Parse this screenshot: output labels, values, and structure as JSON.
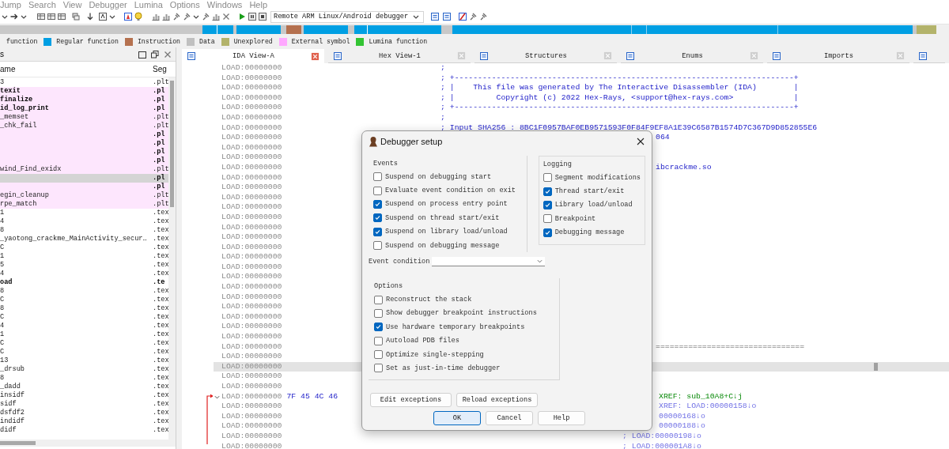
{
  "menu": [
    "Jump",
    "Search",
    "View",
    "Debugger",
    "Lumina",
    "Options",
    "Windows",
    "Help"
  ],
  "toolbar": {
    "debugger": "Remote ARM Linux/Android debugger"
  },
  "legend": [
    {
      "label": "function"
    },
    {
      "label": "Regular function",
      "color": "#009fe3"
    },
    {
      "label": "Instruction",
      "color": "#b5714f"
    },
    {
      "label": "Data",
      "color": "#c0c0c0"
    },
    {
      "label": "Unexplored",
      "color": "#b3b36b"
    },
    {
      "label": "External symbol",
      "color": "#ffa8ff"
    },
    {
      "label": "Lumina function",
      "color": "#33c433"
    }
  ],
  "functions_panel": {
    "title": "s",
    "columns": [
      "ame",
      "Seg"
    ],
    "rows": [
      {
        "name": "3",
        "segment": ".plt",
        "kind": "regular",
        "bold": false,
        "selected": false
      },
      {
        "name": "texit",
        "segment": ".pl",
        "kind": "external",
        "bold": true,
        "selected": false
      },
      {
        "name": "finalize",
        "segment": ".pl",
        "kind": "external",
        "bold": true,
        "selected": false
      },
      {
        "name": "id_log_print",
        "segment": ".pl",
        "kind": "external",
        "bold": true,
        "selected": false
      },
      {
        "name": "_memset",
        "segment": ".plt",
        "kind": "external",
        "bold": false,
        "selected": false
      },
      {
        "name": "_chk_fail",
        "segment": ".plt",
        "kind": "external",
        "bold": false,
        "selected": false
      },
      {
        "segment": ".pl",
        "kind": "external",
        "bold": true,
        "selected": false
      },
      {
        "segment": ".pl",
        "kind": "external",
        "bold": true,
        "selected": false
      },
      {
        "segment": ".pl",
        "kind": "external",
        "bold": true,
        "selected": false
      },
      {
        "segment": ".pl",
        "kind": "external",
        "bold": true,
        "selected": false
      },
      {
        "name": "wind_Find_exidx",
        "segment": ".plt",
        "kind": "external",
        "bold": false,
        "selected": false
      },
      {
        "segment": ".pl",
        "kind": "external",
        "bold": true,
        "selected": true
      },
      {
        "segment": ".pl",
        "kind": "external",
        "bold": true,
        "selected": false
      },
      {
        "name": "egin_cleanup",
        "segment": ".plt",
        "kind": "external",
        "bold": false,
        "selected": false
      },
      {
        "name": "rpe_match",
        "segment": ".plt",
        "kind": "external",
        "bold": false,
        "selected": false
      },
      {
        "name": "1",
        "segment": ".tex",
        "kind": "regular",
        "bold": false,
        "selected": false
      },
      {
        "name": "4",
        "segment": ".tex",
        "kind": "regular",
        "bold": false,
        "selected": false
      },
      {
        "name": "8",
        "segment": ".tex",
        "kind": "regular",
        "bold": false,
        "selected": false
      },
      {
        "name": "_yaotong_crackme_MainActivity_secur…",
        "segment": ".tex",
        "kind": "regular",
        "bold": false,
        "selected": false
      },
      {
        "name": "C",
        "segment": ".tex",
        "kind": "regular",
        "bold": false,
        "selected": false
      },
      {
        "name": "1",
        "segment": ".tex",
        "kind": "regular",
        "bold": false,
        "selected": false
      },
      {
        "name": "5",
        "segment": ".tex",
        "kind": "regular",
        "bold": false,
        "selected": false
      },
      {
        "name": "4",
        "segment": ".tex",
        "kind": "regular",
        "bold": false,
        "selected": false
      },
      {
        "name": "oad",
        "segment": ".te",
        "kind": "regular",
        "bold": true,
        "selected": false
      },
      {
        "name": "8",
        "segment": ".tex",
        "kind": "regular",
        "bold": false,
        "selected": false
      },
      {
        "name": "C",
        "segment": ".tex",
        "kind": "regular",
        "bold": false,
        "selected": false
      },
      {
        "name": "8",
        "segment": ".tex",
        "kind": "regular",
        "bold": false,
        "selected": false
      },
      {
        "name": "C",
        "segment": ".tex",
        "kind": "regular",
        "bold": false,
        "selected": false
      },
      {
        "name": "4",
        "segment": ".tex",
        "kind": "regular",
        "bold": false,
        "selected": false
      },
      {
        "name": "1",
        "segment": ".tex",
        "kind": "regular",
        "bold": false,
        "selected": false
      },
      {
        "name": "C",
        "segment": ".tex",
        "kind": "regular",
        "bold": false,
        "selected": false
      },
      {
        "name": "C",
        "segment": ".tex",
        "kind": "regular",
        "bold": false,
        "selected": false
      },
      {
        "name": "13",
        "segment": ".tex",
        "kind": "regular",
        "bold": false,
        "selected": false
      },
      {
        "name": "_drsub",
        "segment": ".tex",
        "kind": "regular",
        "bold": false,
        "selected": false
      },
      {
        "name": "8",
        "segment": ".tex",
        "kind": "regular",
        "bold": false,
        "selected": false
      },
      {
        "name": "_dadd",
        "segment": ".tex",
        "kind": "regular",
        "bold": false,
        "selected": false
      },
      {
        "name": "insidf",
        "segment": ".tex",
        "kind": "regular",
        "bold": false,
        "selected": false
      },
      {
        "name": "sidf",
        "segment": ".tex",
        "kind": "regular",
        "bold": false,
        "selected": false
      },
      {
        "name": "dsfdf2",
        "segment": ".tex",
        "kind": "regular",
        "bold": false,
        "selected": false
      },
      {
        "name": "indidf",
        "segment": ".tex",
        "kind": "regular",
        "bold": false,
        "selected": false
      },
      {
        "name": "didf",
        "segment": ".tex",
        "kind": "regular",
        "bold": false,
        "selected": false
      }
    ]
  },
  "tabs": [
    {
      "label": "IDA View-A",
      "selected": true
    },
    {
      "label": "Hex View-1",
      "selected": false
    },
    {
      "label": "Structures",
      "selected": false
    },
    {
      "label": "Enums",
      "selected": false
    },
    {
      "label": "Imports",
      "selected": false
    }
  ],
  "listing": {
    "lines": [
      {
        "address": "LOAD:00000000",
        "selected": false,
        "jump_arrow": false,
        "fold": false,
        "text": ";",
        "kind": "comment"
      },
      {
        "address": "LOAD:00000000",
        "selected": false,
        "jump_arrow": false,
        "fold": false,
        "text": "; +-------------------------------------------------------------------------+",
        "kind": "comment"
      },
      {
        "address": "LOAD:00000000",
        "selected": false,
        "jump_arrow": false,
        "fold": false,
        "text": "; |    This file was generated by The Interactive Disassembler (IDA)        |",
        "kind": "comment"
      },
      {
        "address": "LOAD:00000000",
        "selected": false,
        "jump_arrow": false,
        "fold": false,
        "text": "; |         Copyright (c) 2022 Hex-Rays, <support@hex-rays.com>             |",
        "kind": "comment"
      },
      {
        "address": "LOAD:00000000",
        "selected": false,
        "jump_arrow": false,
        "fold": false,
        "text": "; +-------------------------------------------------------------------------+",
        "kind": "comment"
      },
      {
        "address": "LOAD:00000000",
        "selected": false,
        "jump_arrow": false,
        "fold": false,
        "text": ";",
        "kind": "comment"
      },
      {
        "address": "LOAD:00000000",
        "selected": false,
        "jump_arrow": false,
        "fold": false,
        "text": "; Input SHA256 : 8BC1F0957BAF0EB9571593F0F84F9EF8A1E39C6587B1574D7C367D9D852855E6",
        "kind": "comment"
      },
      {
        "address": "LOAD:00000000",
        "selected": false,
        "jump_arrow": false,
        "fold": false,
        "text": "064",
        "kind": "tail"
      },
      {
        "address": "LOAD:00000000",
        "selected": false,
        "jump_arrow": false,
        "fold": false
      },
      {
        "address": "LOAD:00000000",
        "selected": false,
        "jump_arrow": false,
        "fold": false
      },
      {
        "address": "LOAD:00000000",
        "selected": false,
        "jump_arrow": false,
        "fold": false,
        "text": "ibcrackme.so",
        "kind": "tail"
      },
      {
        "address": "LOAD:00000000",
        "selected": false,
        "jump_arrow": false,
        "fold": false
      },
      {
        "address": "LOAD:00000000",
        "selected": false,
        "jump_arrow": false,
        "fold": false
      },
      {
        "address": "LOAD:00000000",
        "selected": false,
        "jump_arrow": false,
        "fold": false
      },
      {
        "address": "LOAD:00000000",
        "selected": false,
        "jump_arrow": false,
        "fold": false
      },
      {
        "address": "LOAD:00000000",
        "selected": false,
        "jump_arrow": false,
        "fold": false
      },
      {
        "address": "LOAD:00000000",
        "selected": false,
        "jump_arrow": false,
        "fold": false
      },
      {
        "address": "LOAD:00000000",
        "selected": false,
        "jump_arrow": false,
        "fold": false
      },
      {
        "address": "LOAD:00000000",
        "selected": false,
        "jump_arrow": false,
        "fold": false
      },
      {
        "address": "LOAD:00000000",
        "selected": false,
        "jump_arrow": false,
        "fold": false
      },
      {
        "address": "LOAD:00000000",
        "selected": false,
        "jump_arrow": false,
        "fold": false
      },
      {
        "address": "LOAD:00000000",
        "selected": false,
        "jump_arrow": false,
        "fold": false
      },
      {
        "address": "LOAD:00000000",
        "selected": false,
        "jump_arrow": false,
        "fold": false
      },
      {
        "address": "LOAD:00000000",
        "selected": false,
        "jump_arrow": false,
        "fold": false
      },
      {
        "address": "LOAD:00000000",
        "selected": false,
        "jump_arrow": false,
        "fold": false
      },
      {
        "address": "LOAD:00000000",
        "selected": false,
        "jump_arrow": false,
        "fold": false
      },
      {
        "address": "LOAD:00000000",
        "selected": false,
        "jump_arrow": false,
        "fold": false
      },
      {
        "address": "LOAD:00000000",
        "selected": false,
        "jump_arrow": false,
        "fold": false
      },
      {
        "address": "LOAD:00000000",
        "selected": false,
        "jump_arrow": false,
        "fold": false,
        "text": "================================",
        "kind": "rule"
      },
      {
        "address": "LOAD:00000000",
        "selected": false,
        "jump_arrow": false,
        "fold": false
      },
      {
        "address": "LOAD:00000000",
        "selected": true,
        "jump_arrow": false,
        "fold": false
      },
      {
        "address": "LOAD:00000000",
        "selected": false,
        "jump_arrow": false,
        "fold": false
      },
      {
        "address": "LOAD:00000000",
        "selected": false,
        "jump_arrow": false,
        "fold": false
      },
      {
        "address": "LOAD:00000000",
        "selected": false,
        "jump_arrow": true,
        "fold": true,
        "bytes": "7F 45 4C 46",
        "text": "XREF: sub_10A8+C↓j",
        "kind": "code_xref"
      },
      {
        "address": "LOAD:00000000",
        "selected": false,
        "jump_arrow": false,
        "fold": false,
        "text": "XREF: LOAD:00000158↓o",
        "kind": "data_xref"
      },
      {
        "address": "LOAD:00000000",
        "selected": false,
        "jump_arrow": false,
        "fold": false,
        "text": "00000168↓o",
        "kind": "data_xref"
      },
      {
        "address": "LOAD:00000000",
        "selected": false,
        "jump_arrow": false,
        "fold": false,
        "text": "00000188↓o",
        "kind": "data_xref"
      },
      {
        "address": "LOAD:00000000",
        "selected": false,
        "jump_arrow": false,
        "fold": false,
        "text": "; LOAD:00000198↓o",
        "kind": "xref"
      },
      {
        "address": "LOAD:00000000",
        "selected": false,
        "jump_arrow": false,
        "fold": false,
        "text": "; LOAD:000001A8↓o",
        "kind": "xref"
      }
    ]
  },
  "dialog": {
    "title": "Debugger setup",
    "events": {
      "label": "Events",
      "items": [
        {
          "label": "Suspend on debugging start",
          "checked": false
        },
        {
          "label": "Evaluate event condition on exit",
          "checked": false
        },
        {
          "label": "Suspend on process entry point",
          "checked": true
        },
        {
          "label": "Suspend on thread start/exit",
          "checked": true
        },
        {
          "label": "Suspend on library load/unload",
          "checked": true
        },
        {
          "label": "Suspend on debugging message",
          "checked": false
        }
      ]
    },
    "logging": {
      "label": "Logging",
      "items": [
        {
          "label": "Segment modifications",
          "checked": false
        },
        {
          "label": "Thread start/exit",
          "checked": true
        },
        {
          "label": "Library load/unload",
          "checked": true
        },
        {
          "label": "Breakpoint",
          "checked": false
        },
        {
          "label": "Debugging message",
          "checked": true
        }
      ]
    },
    "event_condition": {
      "label": "Event condition"
    },
    "options": {
      "label": "Options",
      "items": [
        {
          "label": "Reconstruct the stack",
          "checked": false
        },
        {
          "label": "Show debugger breakpoint instructions",
          "checked": false
        },
        {
          "label": "Use hardware temporary breakpoints",
          "checked": true
        },
        {
          "label": "Autoload PDB files",
          "checked": false
        },
        {
          "label": "Optimize single-stepping",
          "checked": false
        },
        {
          "label": "Set as just-in-time debugger",
          "checked": false
        }
      ]
    },
    "exception_buttons": [
      "Edit exceptions",
      "Reload exceptions"
    ],
    "buttons": [
      {
        "label": "OK",
        "default": true
      },
      {
        "label": "Cancel",
        "default": false
      },
      {
        "label": "Help",
        "default": false
      }
    ]
  }
}
